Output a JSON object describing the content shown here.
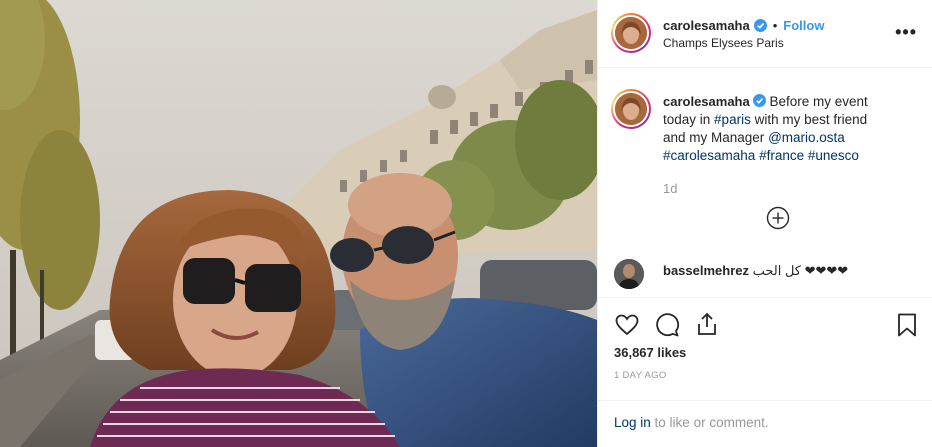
{
  "post": {
    "author": {
      "username": "carolesamaha",
      "verified": true,
      "follow_label": "Follow",
      "separator": "•",
      "location": "Champs Elysees Paris"
    },
    "more_icon": "more-options-icon",
    "caption": {
      "username": "carolesamaha",
      "text_before": " Before my event today in ",
      "hashtag_paris": "#paris",
      "text_middle": " with my best friend and my Manager ",
      "mention": "@mario.osta",
      "hashtag_carolesamaha": "#carolesamaha",
      "hashtag_france": "#france",
      "hashtag_unesco": "#unesco",
      "time_ago": "1d"
    },
    "load_more_icon": "plus-circle-icon",
    "comments": [
      {
        "username": "basselmehrez",
        "text": "كل الحب ❤❤❤❤"
      }
    ],
    "actions": {
      "like_icon": "heart-icon",
      "comment_icon": "comment-icon",
      "share_icon": "share-icon",
      "save_icon": "bookmark-icon"
    },
    "likes": "36,867 likes",
    "posted": "1 DAY AGO",
    "login": {
      "link": "Log in",
      "rest": " to like or comment."
    }
  },
  "colors": {
    "link": "#003569",
    "follow": "#3897f0",
    "muted": "#999999",
    "border": "#efefef"
  }
}
